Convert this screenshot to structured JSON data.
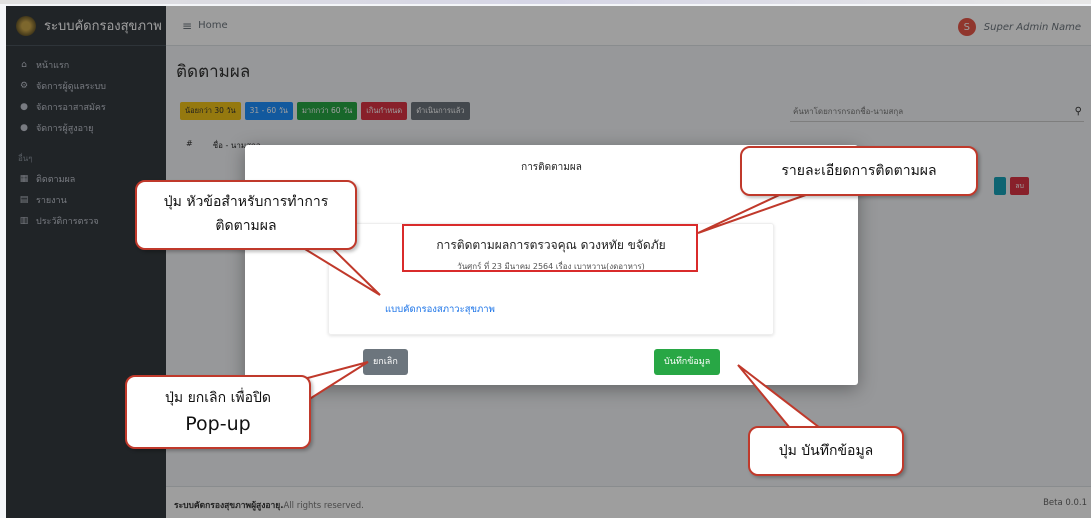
{
  "app": {
    "brand": "ระบบคัดกรองสุขภาพ",
    "home": "Home",
    "user_initial": "S",
    "user_name": "Super Admin Name"
  },
  "sidebar": {
    "items": [
      {
        "icon": "home-icon",
        "label": "หน้าแรก"
      },
      {
        "icon": "users-cog-icon",
        "label": "จัดการผู้ดูแลระบบ"
      },
      {
        "icon": "user-group-icon",
        "label": "จัดการอาสาสมัคร"
      },
      {
        "icon": "users-icon",
        "label": "จัดการผู้สูงอายุ"
      }
    ],
    "section_header": "อื่นๆ",
    "items2": [
      {
        "icon": "calendar-icon",
        "label": "ติดตามผล"
      },
      {
        "icon": "file-icon",
        "label": "รายงาน"
      },
      {
        "icon": "history-icon",
        "label": "ประวัติการตรวจ"
      }
    ]
  },
  "page": {
    "title": "ติดตามผล",
    "filters": [
      {
        "label": "น้อยกว่า 30 วัน",
        "color": "#f0c419",
        "text_color": "#333"
      },
      {
        "label": "31 - 60 วัน",
        "color": "#1e90ff",
        "text_color": "#fff"
      },
      {
        "label": "มากกว่า 60 วัน",
        "color": "#28a745",
        "text_color": "#fff"
      },
      {
        "label": "เกินกำหนด",
        "color": "#dc3545",
        "text_color": "#fff"
      },
      {
        "label": "ดำเนินการแล้ว",
        "color": "#6c757d",
        "text_color": "#fff"
      }
    ],
    "search_placeholder": "ค้นหาโดยการกรอกชื่อ-นามสกุล",
    "table_headers": [
      "#",
      "ชื่อ - นามสกุล"
    ],
    "row_delete": "ลบ"
  },
  "modal": {
    "title": "การติดตามผล",
    "main_text": "การติดตามผลการตรวจคุณ ดวงหทัย ขจัดภัย",
    "sub_text": "วันศุกร์ ที่ 23 มีนาคม 2564 เรื่อง เบาหวาน(งดอาหาร)",
    "link": "แบบคัดกรองสภาวะสุขภาพ",
    "cancel": "ยกเลิก",
    "save": "บันทึกข้อมูล"
  },
  "footer": {
    "brand": "ระบบคัดกรองสุขภาพผู้สูงอายุ.",
    "rights": "All rights reserved.",
    "version": "Beta 0.0.1"
  },
  "annotations": {
    "header_button": "ปุ่ม หัวข้อสำหรับการทำการ\nติดตามผล",
    "details": "รายละเอียดการติดตามผล",
    "cancel_popup": "ปุ่ม ยกเลิก เพื่อปิด",
    "cancel_popup_2": "Pop-up",
    "save": "ปุ่ม บันทึกข้อมูล"
  }
}
